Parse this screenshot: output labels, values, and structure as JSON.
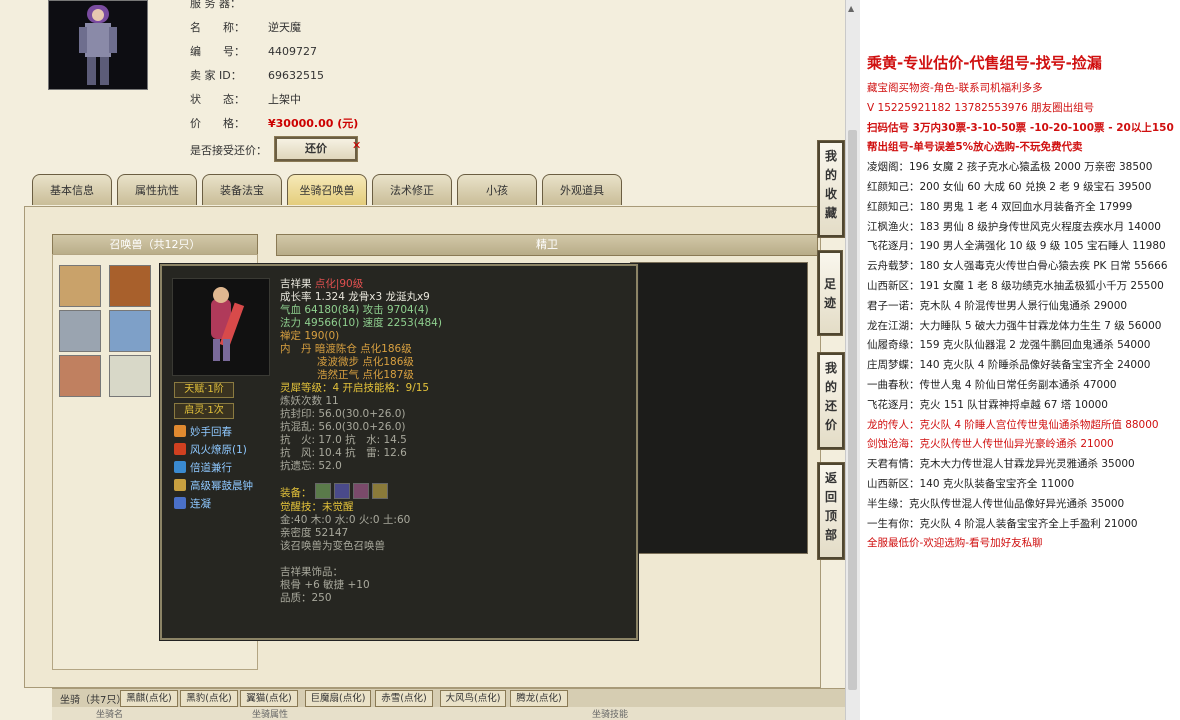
{
  "detail": {
    "top_label": "服 务 器：",
    "name_label": "名　　称：",
    "name": "逆天魔",
    "id_label": "编　　号：",
    "id": "4409727",
    "seller_label": "卖 家 ID：",
    "seller": "69632515",
    "status_label": "状　　态：",
    "status": "上架中",
    "price_label": "价　　格：",
    "price": "¥30000.00 (元)",
    "counter_label": "是否接受还价：",
    "counter_button": "还价"
  },
  "tabs": [
    "基本信息",
    "属性抗性",
    "装备法宝",
    "坐骑召唤兽",
    "法术修正",
    "小孩",
    "外观道具"
  ],
  "pets": {
    "header": "召唤兽（共12只）"
  },
  "skills_header": "精卫",
  "side_buttons": [
    [
      "我",
      "的",
      "收",
      "藏"
    ],
    [
      "足",
      "迹"
    ],
    [
      "我",
      "的",
      "还",
      "价"
    ],
    [
      "返",
      "回",
      "顶",
      "部"
    ]
  ],
  "tooltip": {
    "name": "吉祥果",
    "level": "点化|90级",
    "growth": "成长率 1.324  龙骨x3  龙涎丸x9",
    "hp": "气血 64180(84)  攻击 9704(4)",
    "mp": "法力 49566(10)  速度 2253(484)",
    "mp_spirit": "禅定 190(0)",
    "neidan1": "内　丹  暗渡陈仓  点化186级",
    "neidan2": "凌波微步  点化186级",
    "neidan3": "浩然正气  点化187级",
    "soul": "灵犀等级：4  开启技能格：9/15",
    "refine": "炼妖次数 11",
    "res1": "抗封印: 56.0(30.0+26.0)",
    "res2": "抗混乱: 56.0(30.0+26.0)",
    "res3": "抗　火: 17.0  抗　水: 14.5",
    "res4": "抗　风: 10.4  抗　雷: 12.6",
    "res5": "抗遗忘: 52.0",
    "equip_label": "装备：",
    "awaken": "觉醒技：未觉醒",
    "attr": "金:40  木:0  水:0  火:0  土:60",
    "intimacy": "亲密度 52147",
    "variant": "该召唤兽为变色召唤兽",
    "ornament_title": "吉祥果饰品：",
    "ornament_stats": "根骨 +6  敏捷 +10",
    "ornament_quality": "品质：250",
    "tag1": "天赋·1阶",
    "tag2": "启灵·1次",
    "skills": [
      "妙手回春",
      "风火燎原(1)",
      "倍道兼行",
      "高级幂鼓晨钟",
      "连凝"
    ]
  },
  "bottom": {
    "header": "坐骑（共7只）",
    "mounts": [
      "黑麒(点化)",
      "黑豹(点化)",
      "翼猫(点化)",
      "巨魔扇(点化)",
      "赤雪(点化)",
      "大风鸟(点化)",
      "腾龙(点化)"
    ],
    "cols": [
      "坐骑名",
      "坐骑属性",
      "坐骑技能"
    ]
  },
  "right": {
    "title": "乘黄-专业估价-代售组号-找号-捡漏",
    "lines": [
      {
        "text": "藏宝阁买物资-角色-联系司机福利多多",
        "style": "red"
      },
      {
        "text": "V 15225921182   13782553976 朋友圈出组号",
        "style": "red"
      },
      {
        "text": "扫码估号 3万内30票-3-10-50票 -10-20-100票 - 20以上150",
        "style": "red bold"
      },
      {
        "text": "帮出组号-单号误差5%放心选购-不玩免费代卖",
        "style": "red bold"
      },
      {
        "text": "凌烟阁：196 女魔 2 孩子克水心猿孟极 2000 万亲密 38500",
        "style": ""
      },
      {
        "text": "红颜知己：200 女仙 60 大成 60 兑换 2 老 9 级宝石 39500",
        "style": ""
      },
      {
        "text": "红颜知己：180 男鬼 1 老 4 双回血水月装备齐全 17999",
        "style": ""
      },
      {
        "text": "江枫渔火：183 男仙 8 级护身传世风克火程度去疾水月 14000",
        "style": ""
      },
      {
        "text": "飞花逐月：190 男人全满强化 10 级 9 级 105 宝石睡人 11980",
        "style": ""
      },
      {
        "text": "云舟载梦：180 女人强毒克火传世白骨心猿去疾 PK 日常 55666",
        "style": ""
      },
      {
        "text": "山西新区：191 女魔 1 老 8 级功绩克水抽孟极狐小千万 25500",
        "style": ""
      },
      {
        "text": "君子一诺：克木队 4 阶混传世男人景行仙鬼通杀 29000",
        "style": ""
      },
      {
        "text": "龙在江湖：大力睡队 5 破大力强牛甘霖龙体力生生 7 级 56000",
        "style": ""
      },
      {
        "text": "仙履奇缘：159 克火队仙器混 2 龙强牛鹏回血鬼通杀 54000",
        "style": ""
      },
      {
        "text": "庄周梦蝶：140 克火队 4 阶睡杀品像好装备宝宝齐全 24000",
        "style": ""
      },
      {
        "text": "一曲春秋：传世人鬼 4 阶仙日常任务副本通杀 47000",
        "style": ""
      },
      {
        "text": "飞花逐月：克火 151 队甘霖神捋卓越 67 塔 10000",
        "style": ""
      },
      {
        "text": "龙的传人：克火队 4 阶睡人宫位传世鬼仙通杀物超所值 88000",
        "style": "red"
      },
      {
        "text": "剑蚀沧海：克火队传世人传世仙异光豪岭通杀 21000",
        "style": "red"
      },
      {
        "text": "天君有情：克木大力传世混人甘霖龙异光灵雅通杀 35000",
        "style": ""
      },
      {
        "text": "山西新区：140 克火队装备宝宝齐全 11000",
        "style": ""
      },
      {
        "text": "半生缘：克火队传世混人传世仙品像好异光通杀 35000",
        "style": ""
      },
      {
        "text": "一生有你：克火队 4 阶混人装备宝宝齐全上手盈利 21000",
        "style": ""
      },
      {
        "text": "全服最低价-欢迎选购-看号加好友私聊",
        "style": "red"
      }
    ]
  }
}
